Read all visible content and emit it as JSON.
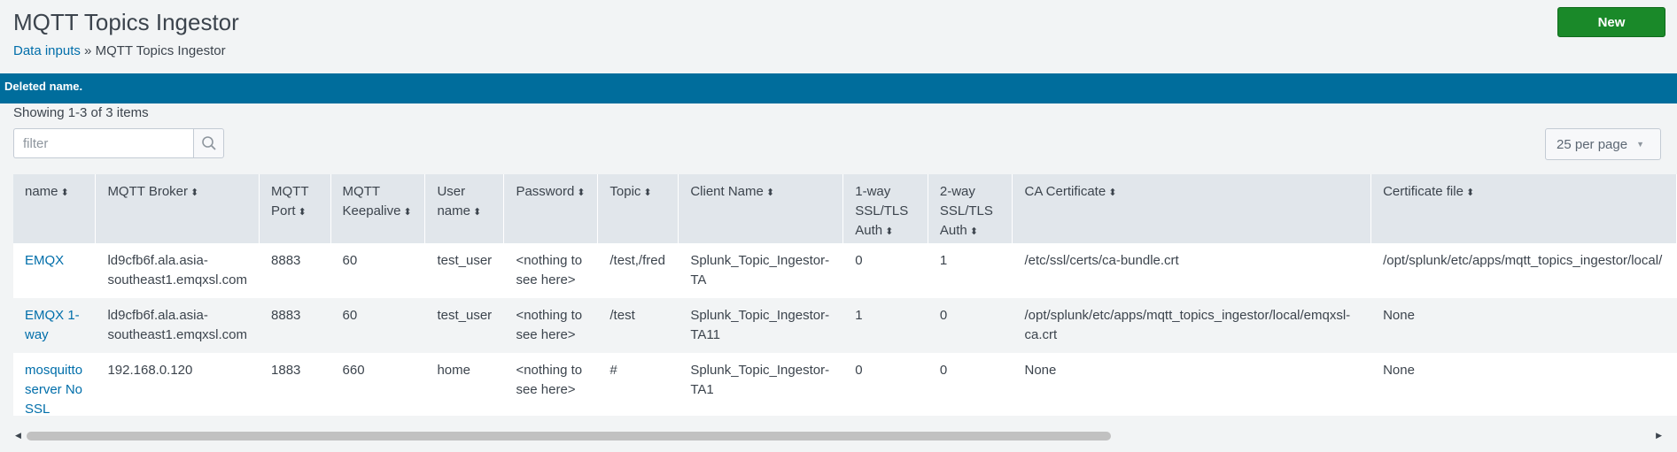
{
  "page": {
    "title": "MQTT Topics Ingestor",
    "breadcrumb": {
      "link": "Data inputs",
      "separator": " » ",
      "current": "MQTT Topics Ingestor"
    },
    "new_button": "New"
  },
  "flash_message": "Deleted name.",
  "list": {
    "showing": "Showing 1-3 of 3 items",
    "filter_placeholder": "filter",
    "per_page": "25 per page"
  },
  "table": {
    "columns": [
      "name",
      "MQTT Broker",
      "MQTT Port",
      "MQTT Keepalive",
      "User name",
      "Password",
      "Topic",
      "Client Name",
      "1-way SSL/TLS Auth",
      "2-way SSL/TLS Auth",
      "CA Certificate",
      "Certificate file"
    ],
    "rows": [
      [
        "EMQX",
        "ld9cfb6f.ala.asia-southeast1.emqxsl.com",
        "8883",
        "60",
        "test_user",
        "<nothing to see here>",
        "/test,/fred",
        "Splunk_Topic_Ingestor-TA",
        "0",
        "1",
        "/etc/ssl/certs/ca-bundle.crt",
        "/opt/splunk/etc/apps/mqtt_topics_ingestor/local/"
      ],
      [
        "EMQX 1-way",
        "ld9cfb6f.ala.asia-southeast1.emqxsl.com",
        "8883",
        "60",
        "test_user",
        "<nothing to see here>",
        "/test",
        "Splunk_Topic_Ingestor-TA11",
        "1",
        "0",
        "/opt/splunk/etc/apps/mqtt_topics_ingestor/local/emqxsl-ca.crt",
        "None"
      ],
      [
        "mosquitto server No SSL",
        "192.168.0.120",
        "1883",
        "660",
        "home",
        "<nothing to see here>",
        "#",
        "Splunk_Topic_Ingestor-TA1",
        "0",
        "0",
        "None",
        "None"
      ]
    ]
  },
  "icons": {
    "search": "search-icon",
    "sort": "sort-icon",
    "caret": "caret-down-icon"
  },
  "colors": {
    "flash_bg": "#006d9c",
    "new_button_bg": "#1a8929",
    "link": "#006eaa"
  }
}
